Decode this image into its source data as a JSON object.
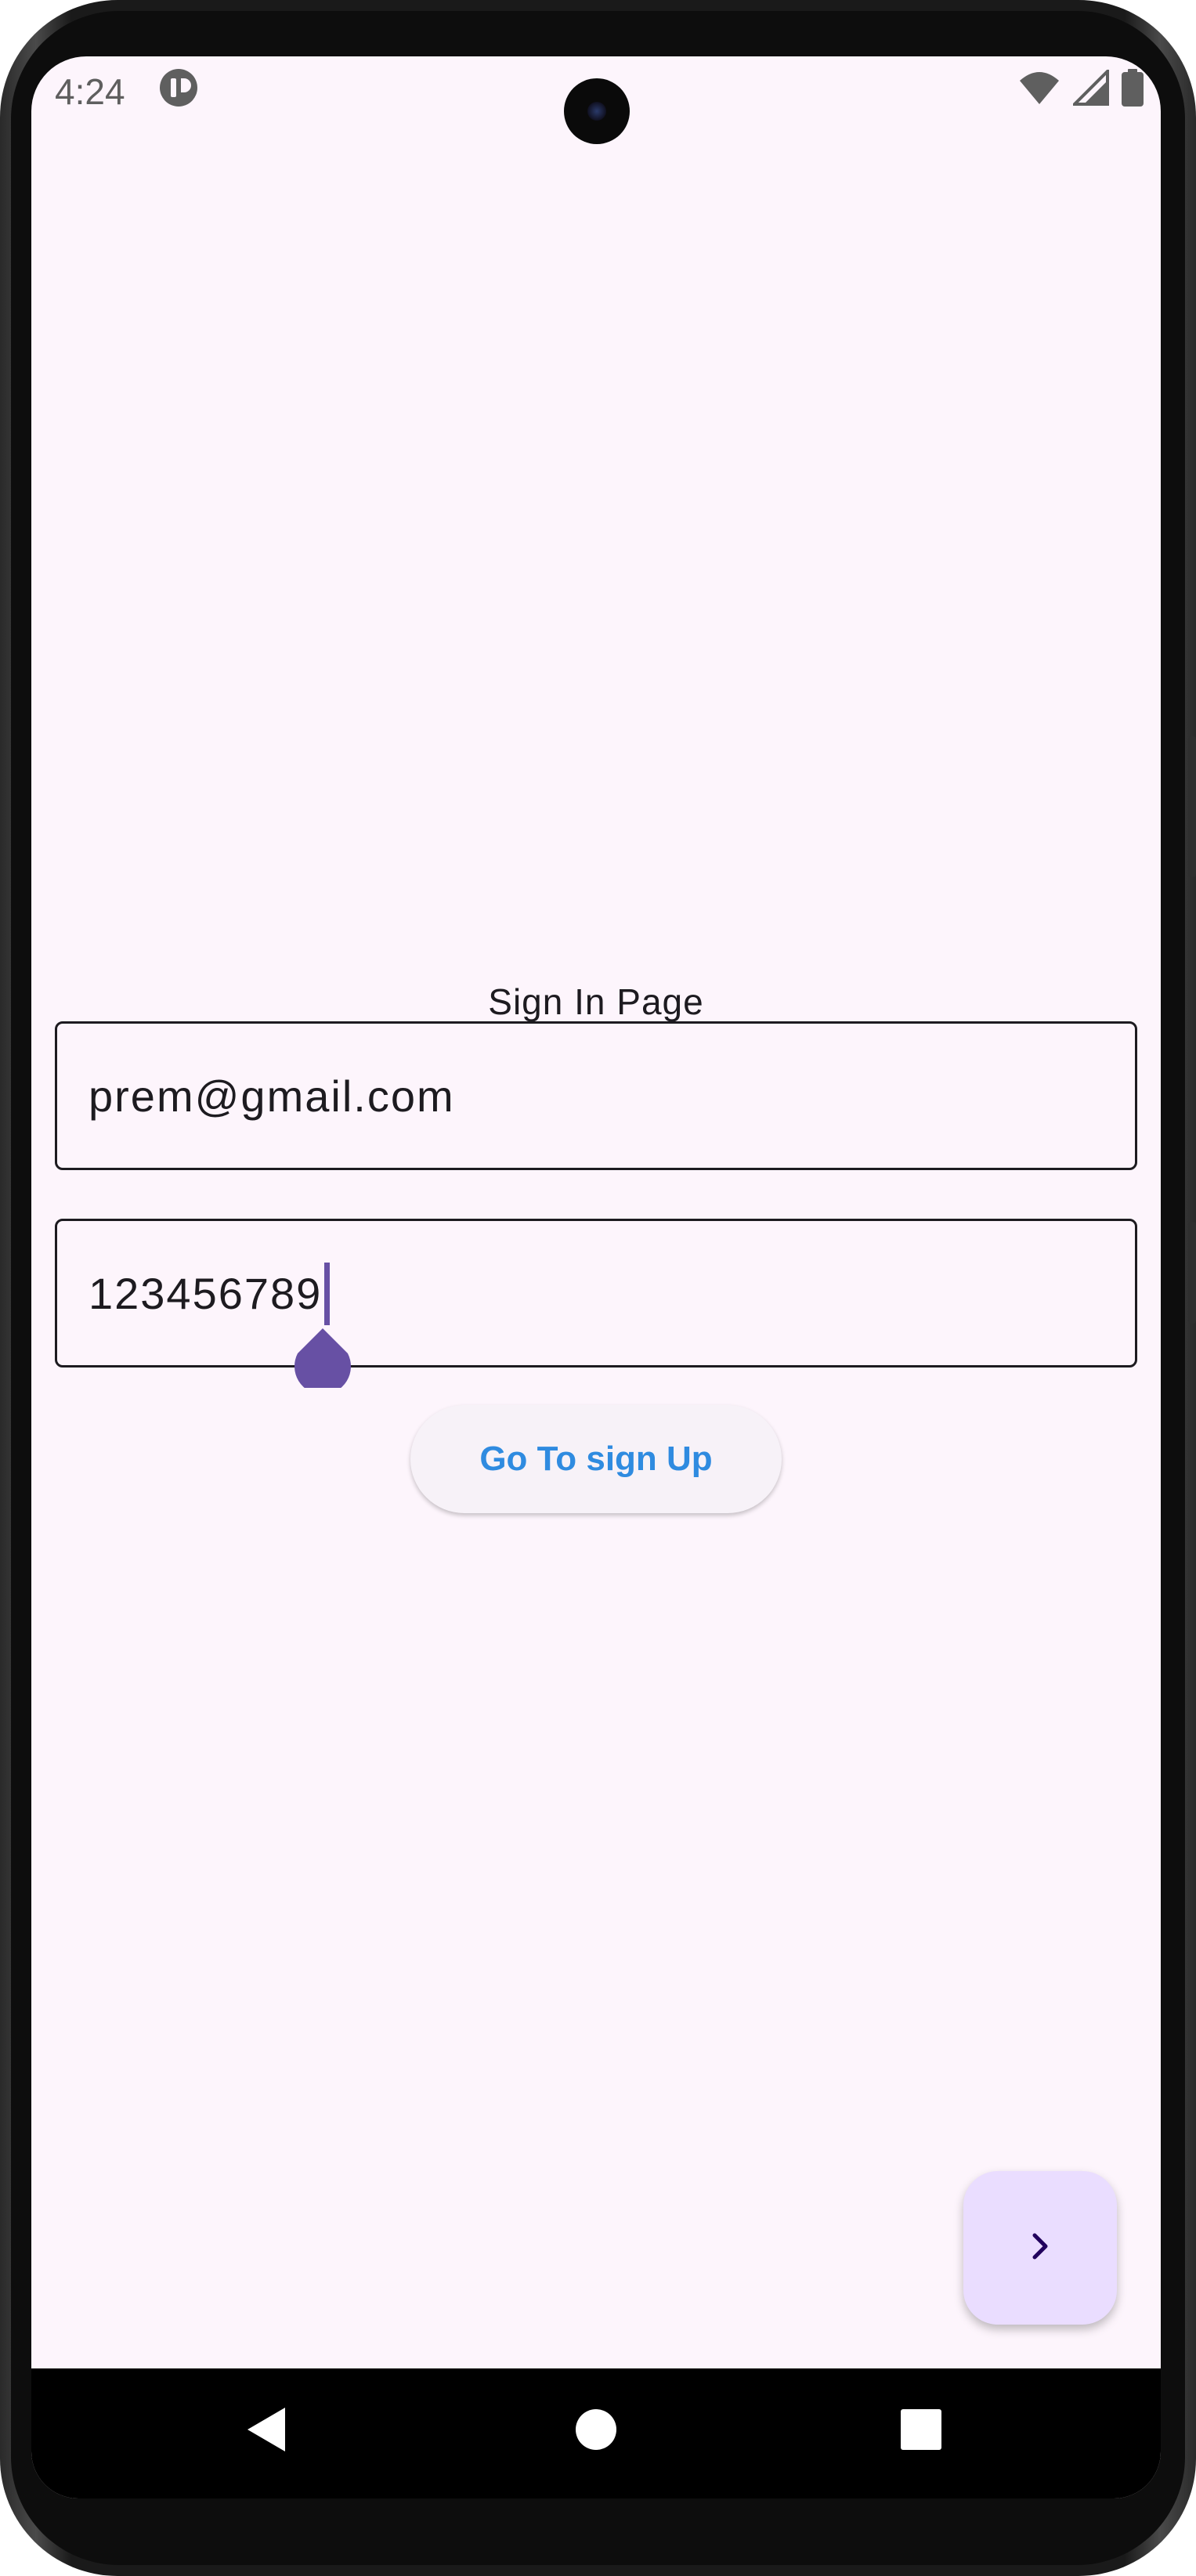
{
  "status_bar": {
    "time": "4:24",
    "app_icon": "pause-circle-icon",
    "icons": [
      "wifi-icon",
      "cellular-signal-icon",
      "battery-icon"
    ]
  },
  "page": {
    "title": "Sign In Page"
  },
  "email_field": {
    "value": "prem@gmail.com"
  },
  "password_field": {
    "value": "123456789"
  },
  "signup_button": {
    "label": "Go To sign Up"
  },
  "fab": {
    "icon": "chevron-right-icon"
  },
  "nav_bar": {
    "back_icon": "back-triangle-icon",
    "home_icon": "home-circle-icon",
    "recents_icon": "recents-square-icon"
  },
  "colors": {
    "background": "#fdf5fc",
    "accent": "#6750a4",
    "button_text": "#2f8be0",
    "fab_background": "#eaddff",
    "fab_icon": "#21005d"
  }
}
